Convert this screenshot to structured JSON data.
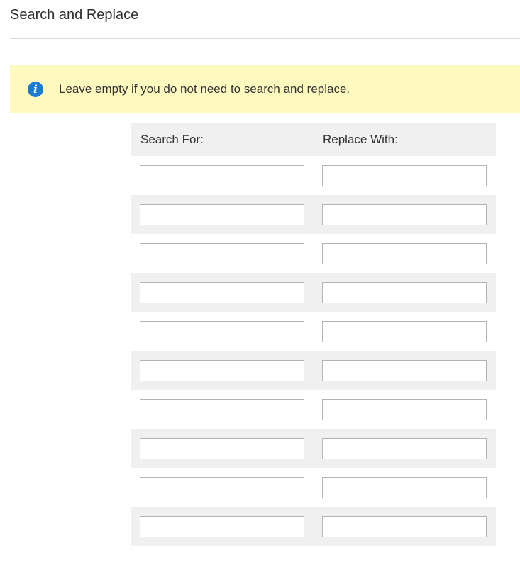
{
  "section": {
    "title": "Search and Replace"
  },
  "notice": {
    "icon": "info-icon",
    "text": "Leave empty if you do not need to search and replace.",
    "background_color": "#fdf9bf",
    "icon_color": "#1b7ad3"
  },
  "table": {
    "headers": {
      "search": "Search For:",
      "replace": "Replace With:"
    },
    "rows": [
      {
        "search": "",
        "replace": ""
      },
      {
        "search": "",
        "replace": ""
      },
      {
        "search": "",
        "replace": ""
      },
      {
        "search": "",
        "replace": ""
      },
      {
        "search": "",
        "replace": ""
      },
      {
        "search": "",
        "replace": ""
      },
      {
        "search": "",
        "replace": ""
      },
      {
        "search": "",
        "replace": ""
      },
      {
        "search": "",
        "replace": ""
      },
      {
        "search": "",
        "replace": ""
      }
    ]
  }
}
